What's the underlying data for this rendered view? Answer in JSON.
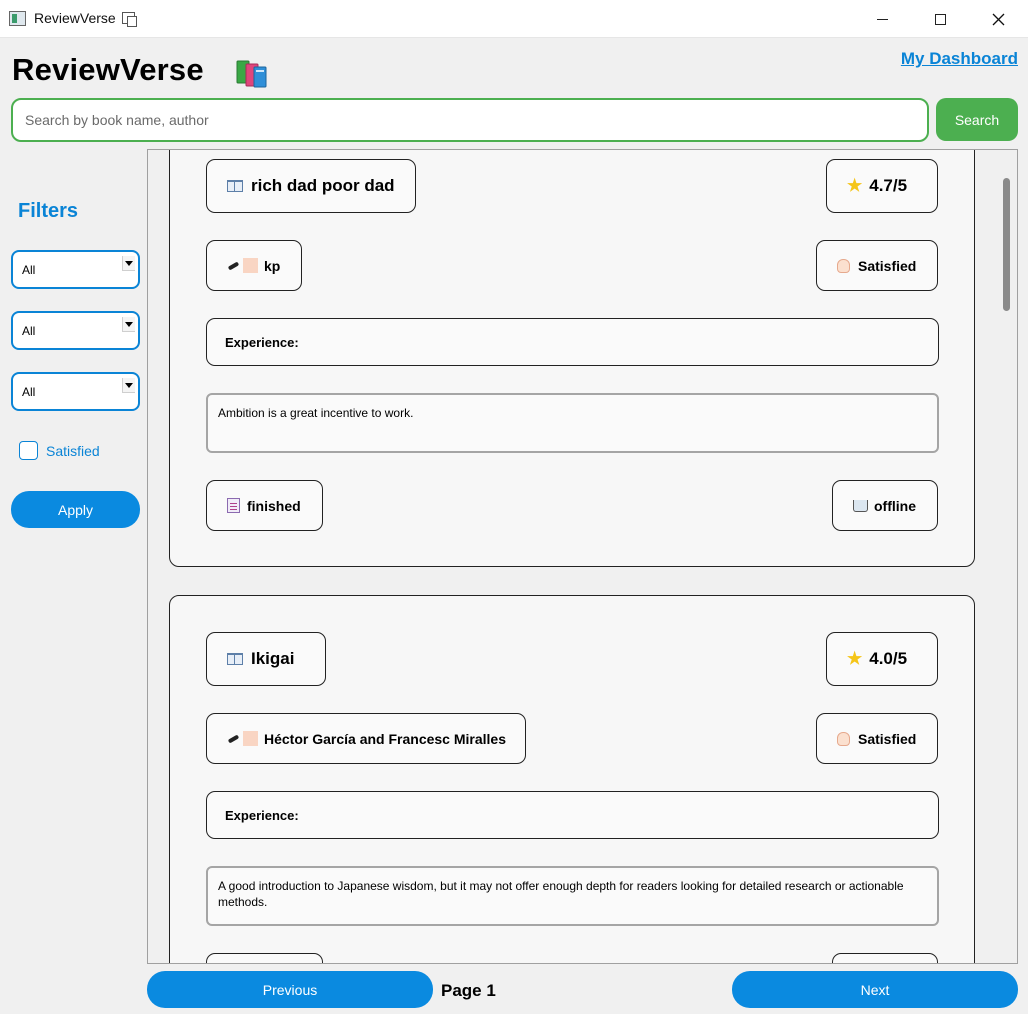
{
  "window": {
    "title": "ReviewVerse"
  },
  "header": {
    "brand": "ReviewVerse",
    "brand_icon": "books-icon",
    "dashboard_link": "My Dashboard"
  },
  "search": {
    "placeholder": "Search by book name, author",
    "value": "",
    "button_label": "Search"
  },
  "sidebar": {
    "title": "Filters",
    "filters": [
      {
        "selected": "All"
      },
      {
        "selected": "All"
      },
      {
        "selected": "All"
      }
    ],
    "checkbox_label": "Satisfied",
    "checkbox_checked": false,
    "apply_label": "Apply"
  },
  "reviews": [
    {
      "book": "rich dad poor dad",
      "rating": "4.7/5",
      "reviewer": "kp",
      "satisfaction": "Satisfied",
      "experience_label": "Experience:",
      "review_text": "Ambition is a great incentive to work.",
      "status": "finished",
      "purchase": "offline"
    },
    {
      "book": "Ikigai",
      "rating": "4.0/5",
      "reviewer": "Héctor García and Francesc Miralles",
      "satisfaction": "Satisfied",
      "experience_label": "Experience:",
      "review_text": "A good introduction to Japanese wisdom, but it may not offer enough depth for readers looking for detailed research or actionable methods."
    }
  ],
  "pagination": {
    "previous_label": "Previous",
    "page_label": "Page 1",
    "next_label": "Next"
  },
  "colors": {
    "accent_blue": "#0a8ae0",
    "search_green": "#4caf50",
    "link_blue": "#0a84d6"
  }
}
